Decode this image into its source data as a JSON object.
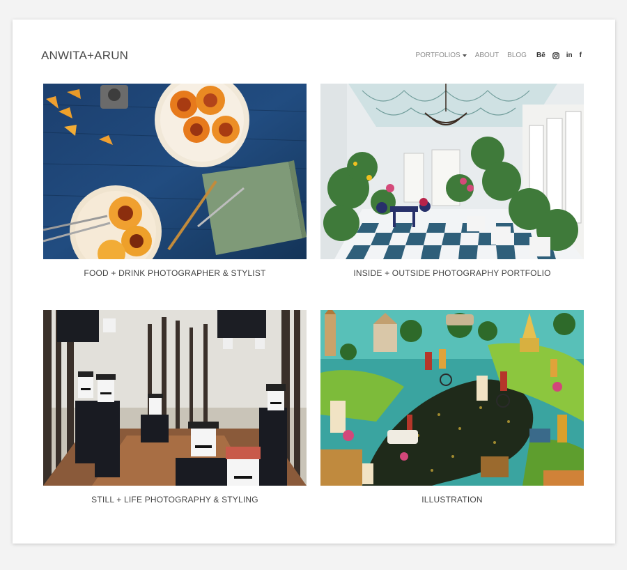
{
  "header": {
    "logo": "ANWITA+ARUN",
    "nav": [
      {
        "label": "PORTFOLIOS",
        "has_dropdown": true
      },
      {
        "label": "ABOUT"
      },
      {
        "label": "BLOG"
      }
    ],
    "social": [
      {
        "icon": "behance-icon",
        "glyph": "Bē"
      },
      {
        "icon": "instagram-icon"
      },
      {
        "icon": "linkedin-icon",
        "glyph": "in"
      },
      {
        "icon": "facebook-icon",
        "glyph": "f"
      }
    ]
  },
  "portfolios": [
    {
      "caption": "FOOD + DRINK PHOTOGRAPHER & STYLIST",
      "image": "food-photo"
    },
    {
      "caption": "INSIDE + OUTSIDE PHOTOGRAPHY PORTFOLIO",
      "image": "interior-photo"
    },
    {
      "caption": "STILL + LIFE PHOTOGRAPHY & STYLING",
      "image": "still-life-photo"
    },
    {
      "caption": "ILLUSTRATION",
      "image": "illustration-collage"
    }
  ],
  "colors": {
    "background": "#f3f3f3",
    "card": "#ffffff",
    "logo": "#4a4a4a",
    "nav": "#8a8a8a"
  }
}
